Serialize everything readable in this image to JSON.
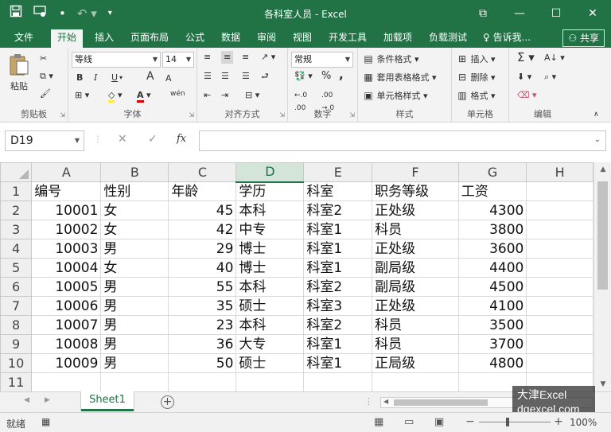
{
  "window": {
    "title": "各科室人员 - Excel",
    "qat": {
      "save_icon": "save-icon",
      "touch_icon": "touch-mode-icon",
      "dot": "•",
      "undo_icon": "undo-icon",
      "customize_icon": "customize-icon"
    },
    "controls": {
      "restore": "⧉",
      "minimize": "—",
      "maximize": "☐",
      "close": "✕"
    }
  },
  "ribbon_tabs": [
    {
      "label": "文件"
    },
    {
      "label": "开始"
    },
    {
      "label": "插入"
    },
    {
      "label": "页面布局"
    },
    {
      "label": "公式"
    },
    {
      "label": "数据"
    },
    {
      "label": "审阅"
    },
    {
      "label": "视图"
    },
    {
      "label": "开发工具"
    },
    {
      "label": "加载项"
    },
    {
      "label": "负载测试"
    }
  ],
  "tell_me": "告诉我...",
  "share": "共享",
  "ribbon": {
    "clipboard": {
      "label": "剪贴板",
      "paste": "粘贴"
    },
    "font": {
      "label": "字体",
      "name": "等线",
      "size": "14",
      "bold": "B",
      "italic": "I",
      "underline": "U",
      "grow": "A",
      "shrink": "A",
      "phonetic": "wén"
    },
    "alignment": {
      "label": "对齐方式"
    },
    "number": {
      "label": "数字",
      "format": "常规",
      "percent": "%",
      "comma": ","
    },
    "styles": {
      "label": "样式",
      "conditional": "条件格式",
      "table": "套用表格格式",
      "cell": "单元格样式"
    },
    "cells": {
      "label": "单元格",
      "insert": "插入",
      "delete": "删除",
      "format": "格式"
    },
    "editing": {
      "label": "编辑"
    }
  },
  "formula_bar": {
    "name_box": "D19",
    "cancel": "✕",
    "enter": "✓",
    "fx": "fx",
    "value": ""
  },
  "columns": [
    "A",
    "B",
    "C",
    "D",
    "E",
    "F",
    "G",
    "H"
  ],
  "selected_column": "D",
  "rows": [
    {
      "n": "1",
      "cells": [
        "编号",
        "性别",
        "年龄",
        "学历",
        "科室",
        "职务等级",
        "工资",
        ""
      ]
    },
    {
      "n": "2",
      "cells": [
        "10001",
        "女",
        "45",
        "本科",
        "科室2",
        "正处级",
        "4300",
        ""
      ]
    },
    {
      "n": "3",
      "cells": [
        "10002",
        "女",
        "42",
        "中专",
        "科室1",
        "科员",
        "3800",
        ""
      ]
    },
    {
      "n": "4",
      "cells": [
        "10003",
        "男",
        "29",
        "博士",
        "科室1",
        "正处级",
        "3600",
        ""
      ]
    },
    {
      "n": "5",
      "cells": [
        "10004",
        "女",
        "40",
        "博士",
        "科室1",
        "副局级",
        "4400",
        ""
      ]
    },
    {
      "n": "6",
      "cells": [
        "10005",
        "男",
        "55",
        "本科",
        "科室2",
        "副局级",
        "4500",
        ""
      ]
    },
    {
      "n": "7",
      "cells": [
        "10006",
        "男",
        "35",
        "硕士",
        "科室3",
        "正处级",
        "4100",
        ""
      ]
    },
    {
      "n": "8",
      "cells": [
        "10007",
        "男",
        "23",
        "本科",
        "科室2",
        "科员",
        "3500",
        ""
      ]
    },
    {
      "n": "9",
      "cells": [
        "10008",
        "男",
        "36",
        "大专",
        "科室1",
        "科员",
        "3700",
        ""
      ]
    },
    {
      "n": "10",
      "cells": [
        "10009",
        "男",
        "50",
        "硕士",
        "科室1",
        "正局级",
        "4800",
        ""
      ]
    },
    {
      "n": "11",
      "cells": [
        "",
        "",
        "",
        "",
        "",
        "",
        "",
        ""
      ]
    }
  ],
  "sheets": [
    {
      "name": "Sheet1",
      "active": true
    }
  ],
  "status": {
    "ready": "就绪",
    "zoom": "100%"
  },
  "watermark": {
    "line1": "大津Excel",
    "line2": "dqexcel.com"
  },
  "colors": {
    "accent": "#217346",
    "ribbon_bg": "#f3f3f3",
    "grid_line": "#d9d9d9"
  }
}
